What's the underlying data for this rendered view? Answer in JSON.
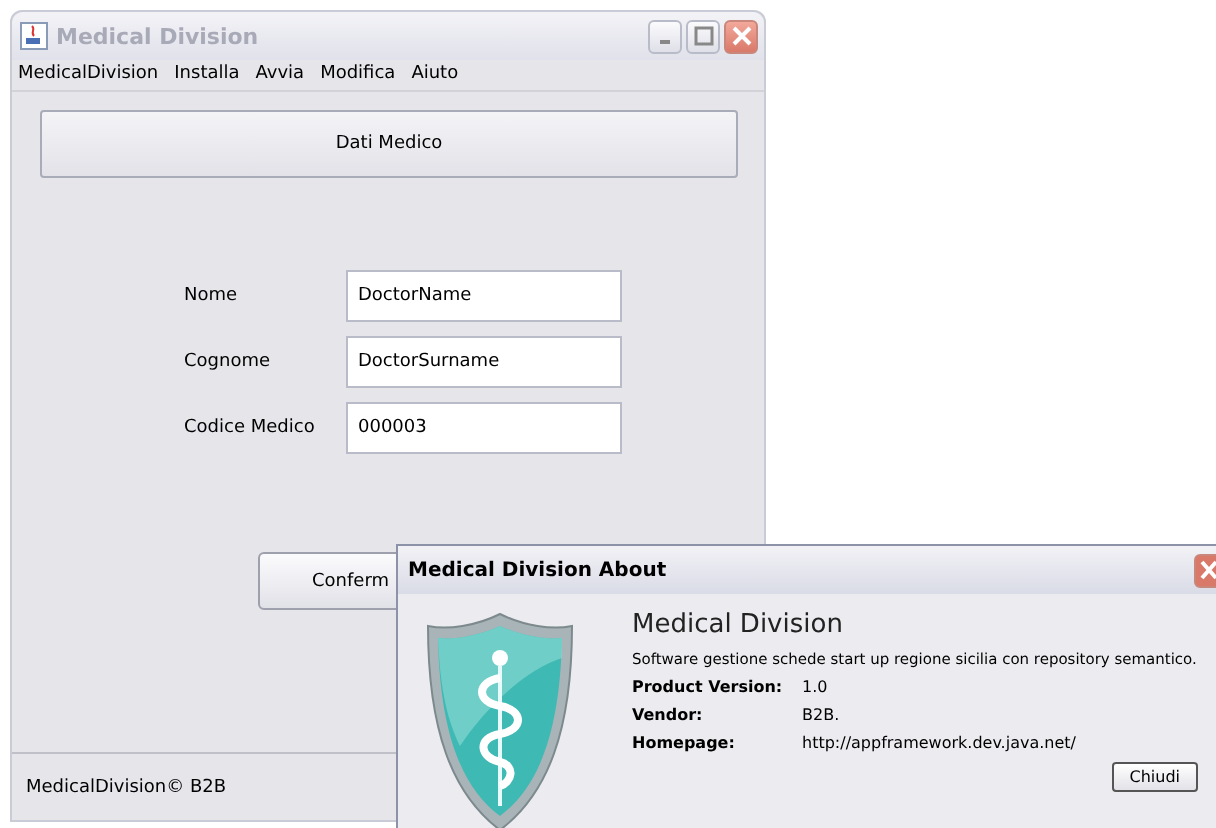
{
  "main_window": {
    "title": "Medical Division",
    "menu": [
      "MedicalDivision",
      "Installa",
      "Avvia",
      "Modifica",
      "Aiuto"
    ],
    "header_button": "Dati Medico",
    "fields": [
      {
        "label": "Nome",
        "value": "DoctorName"
      },
      {
        "label": "Cognome",
        "value": "DoctorSurname"
      },
      {
        "label": "Codice Medico",
        "value": "000003"
      }
    ],
    "confirm_button": "Conferm",
    "status_bar": "MedicalDivision© B2B"
  },
  "about_dialog": {
    "title": "Medical Division About",
    "app_name": "Medical Division",
    "description": "Software gestione schede start up regione sicilia con repository semantico.",
    "properties": [
      {
        "label": "Product Version:",
        "value": "1.0"
      },
      {
        "label": "Vendor:",
        "value": "B2B."
      },
      {
        "label": "Homepage:",
        "value": "http://appframework.dev.java.net/"
      }
    ],
    "close_button": "Chiudi"
  }
}
